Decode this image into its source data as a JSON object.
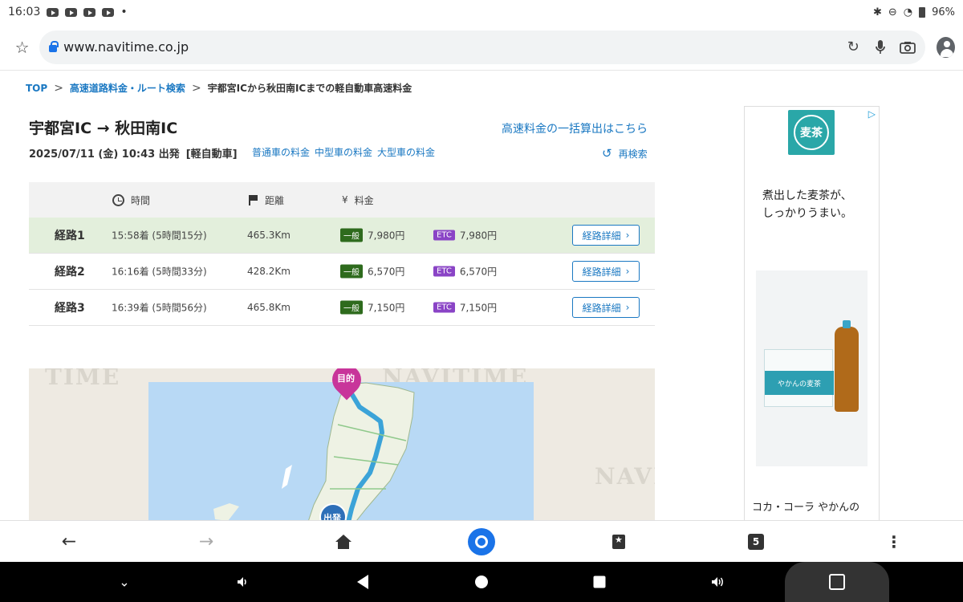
{
  "status_bar": {
    "time": "16:03",
    "dot": "•",
    "battery": "96%",
    "icons": [
      "youtube-icon",
      "youtube-icon",
      "youtube-icon",
      "youtube-icon",
      "bluetooth-icon",
      "dnd-icon",
      "wifi-icon",
      "battery-icon"
    ]
  },
  "browser": {
    "url": "www.navitime.co.jp"
  },
  "breadcrumb": {
    "top": "TOP",
    "sep": ">",
    "section": "高速道路料金・ルート検索",
    "current": "宇都宮ICから秋田南ICまでの軽自動車高速料金"
  },
  "header": {
    "title": "宇都宮IC → 秋田南IC",
    "date": "2025/07/11 (金) 10:43 出発",
    "vehicle": "[軽自動車]",
    "fare_links": [
      "普通車の料金",
      "中型車の料金",
      "大型車の料金"
    ],
    "bulk_link": "高速料金の一括算出はこちら",
    "research": "再検索"
  },
  "table": {
    "headers": {
      "time": "時間",
      "distance": "距離",
      "fare": "料金",
      "yen": "¥"
    },
    "badge_general": "一般",
    "badge_etc": "ETC",
    "detail_label": "経路詳細",
    "rows": [
      {
        "name": "経路1",
        "time": "15:58着 (5時間15分)",
        "distance": "465.3Km",
        "general": "7,980円",
        "etc": "7,980円"
      },
      {
        "name": "経路2",
        "time": "16:16着 (5時間33分)",
        "distance": "428.2Km",
        "general": "6,570円",
        "etc": "6,570円"
      },
      {
        "name": "経路3",
        "time": "16:39着 (5時間56分)",
        "distance": "465.8Km",
        "general": "7,150円",
        "etc": "7,150円"
      }
    ]
  },
  "map": {
    "watermark": "NAVITIME",
    "watermark_left": "TIME",
    "watermark_right": "NAVI",
    "pin_dest": "目的",
    "pin_start": "出発"
  },
  "ad": {
    "logo": "麦茶",
    "copy_line1": "煮出した麦茶が、",
    "copy_line2": "しっかりうまい。",
    "box_label": "やかんの麦茶",
    "caption": "コカ・コーラ やかんの"
  },
  "bottom_nav": {
    "tab_count": "5"
  }
}
